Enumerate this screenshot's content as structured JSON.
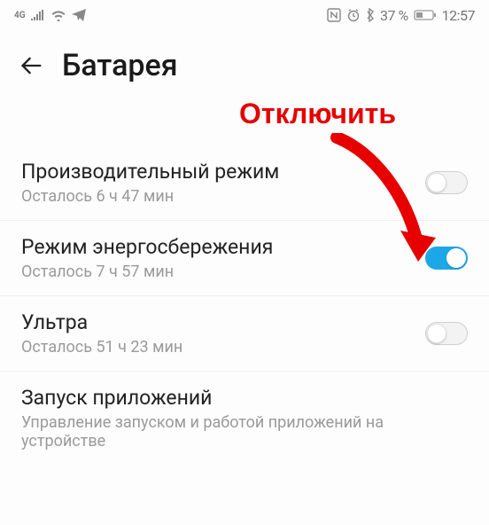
{
  "status": {
    "network_label": "4G",
    "battery_percent": "37 %",
    "time": "12:57"
  },
  "header": {
    "title": "Батарея"
  },
  "annotation": {
    "label": "Отключить"
  },
  "rows": [
    {
      "title": "Производительный режим",
      "subtitle": "Осталось 6 ч 47 мин",
      "toggled": false
    },
    {
      "title": "Режим энергосбережения",
      "subtitle": "Осталось 7 ч 57 мин",
      "toggled": true
    },
    {
      "title": "Ультра",
      "subtitle": "Осталось 51 ч 23 мин",
      "toggled": false
    },
    {
      "title": "Запуск приложений",
      "subtitle": "Управление запуском и работой приложений на устройстве",
      "toggled": null
    }
  ]
}
